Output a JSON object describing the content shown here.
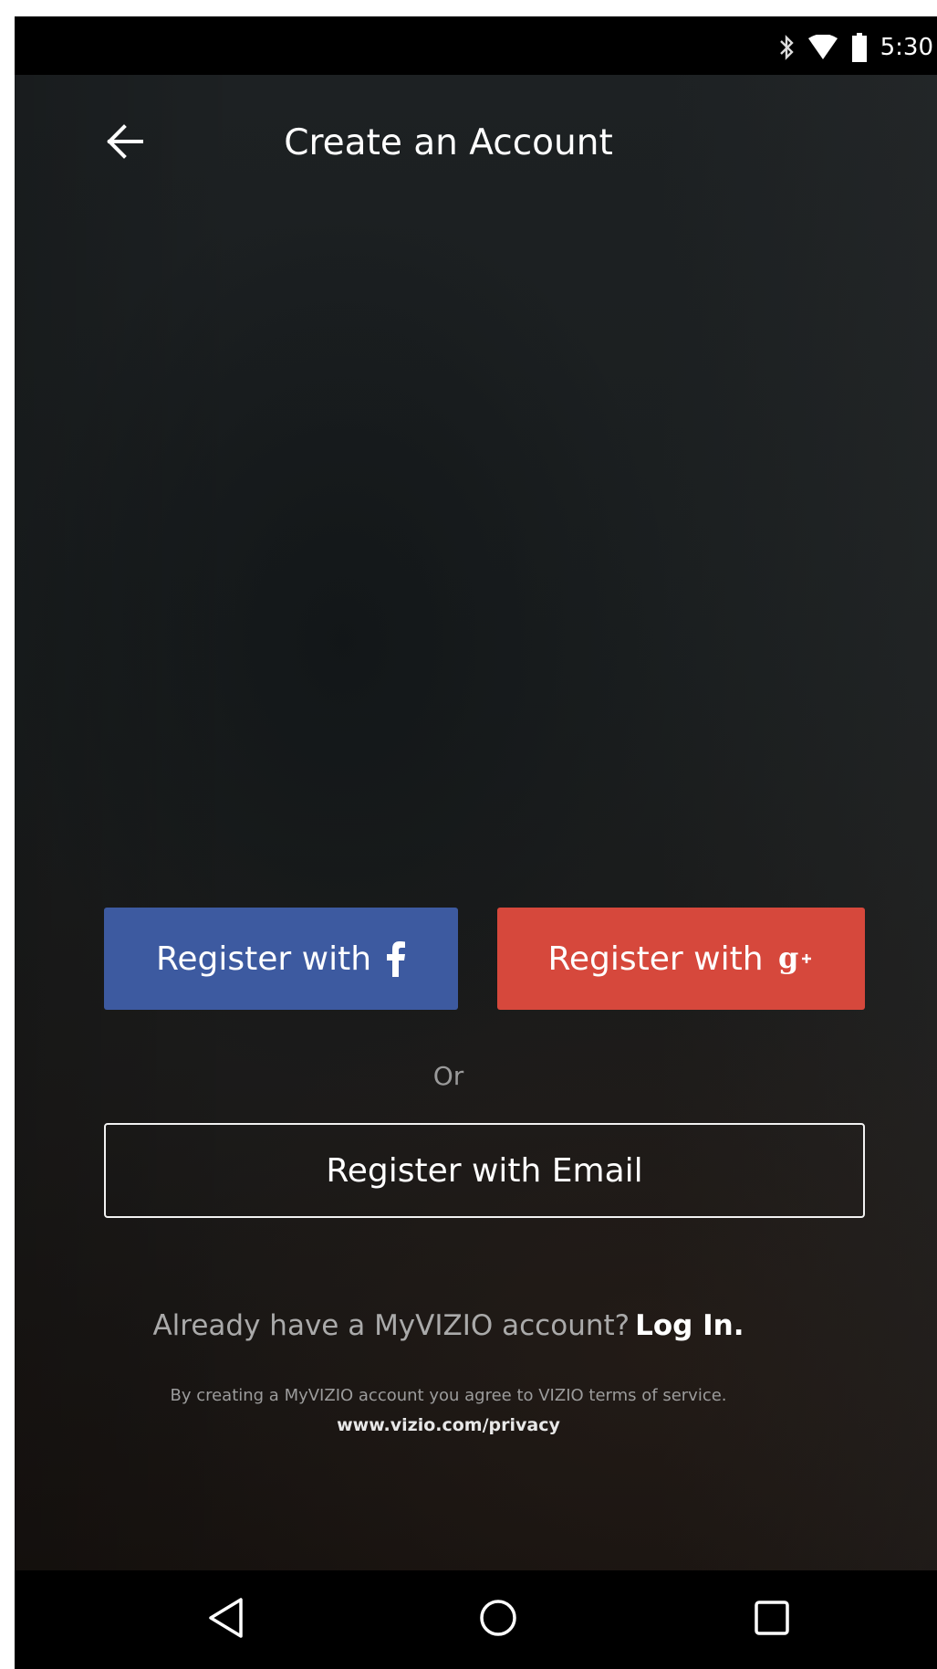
{
  "status_bar": {
    "time": "5:30",
    "icons": [
      "bluetooth-icon",
      "wifi-icon",
      "battery-icon"
    ]
  },
  "header": {
    "back_icon": "arrow-left-icon",
    "title": "Create an Account"
  },
  "register": {
    "facebook_label": "Register with",
    "facebook_icon": "facebook-icon",
    "google_label": "Register with",
    "google_icon": "google-plus-icon",
    "or_label": "Or",
    "email_label": "Register with Email"
  },
  "login": {
    "prompt": "Already have a MyVIZIO account?",
    "link": "Log In."
  },
  "terms": {
    "text": "By creating a MyVIZIO account you agree to VIZIO terms of service.",
    "privacy_link": "www.vizio.com/privacy"
  },
  "nav_bar": {
    "icons": [
      "nav-back-icon",
      "nav-home-icon",
      "nav-recent-apps-icon"
    ]
  },
  "colors": {
    "facebook": "#3d5aa0",
    "google": "#d6483c",
    "background": "#1c1f20"
  }
}
